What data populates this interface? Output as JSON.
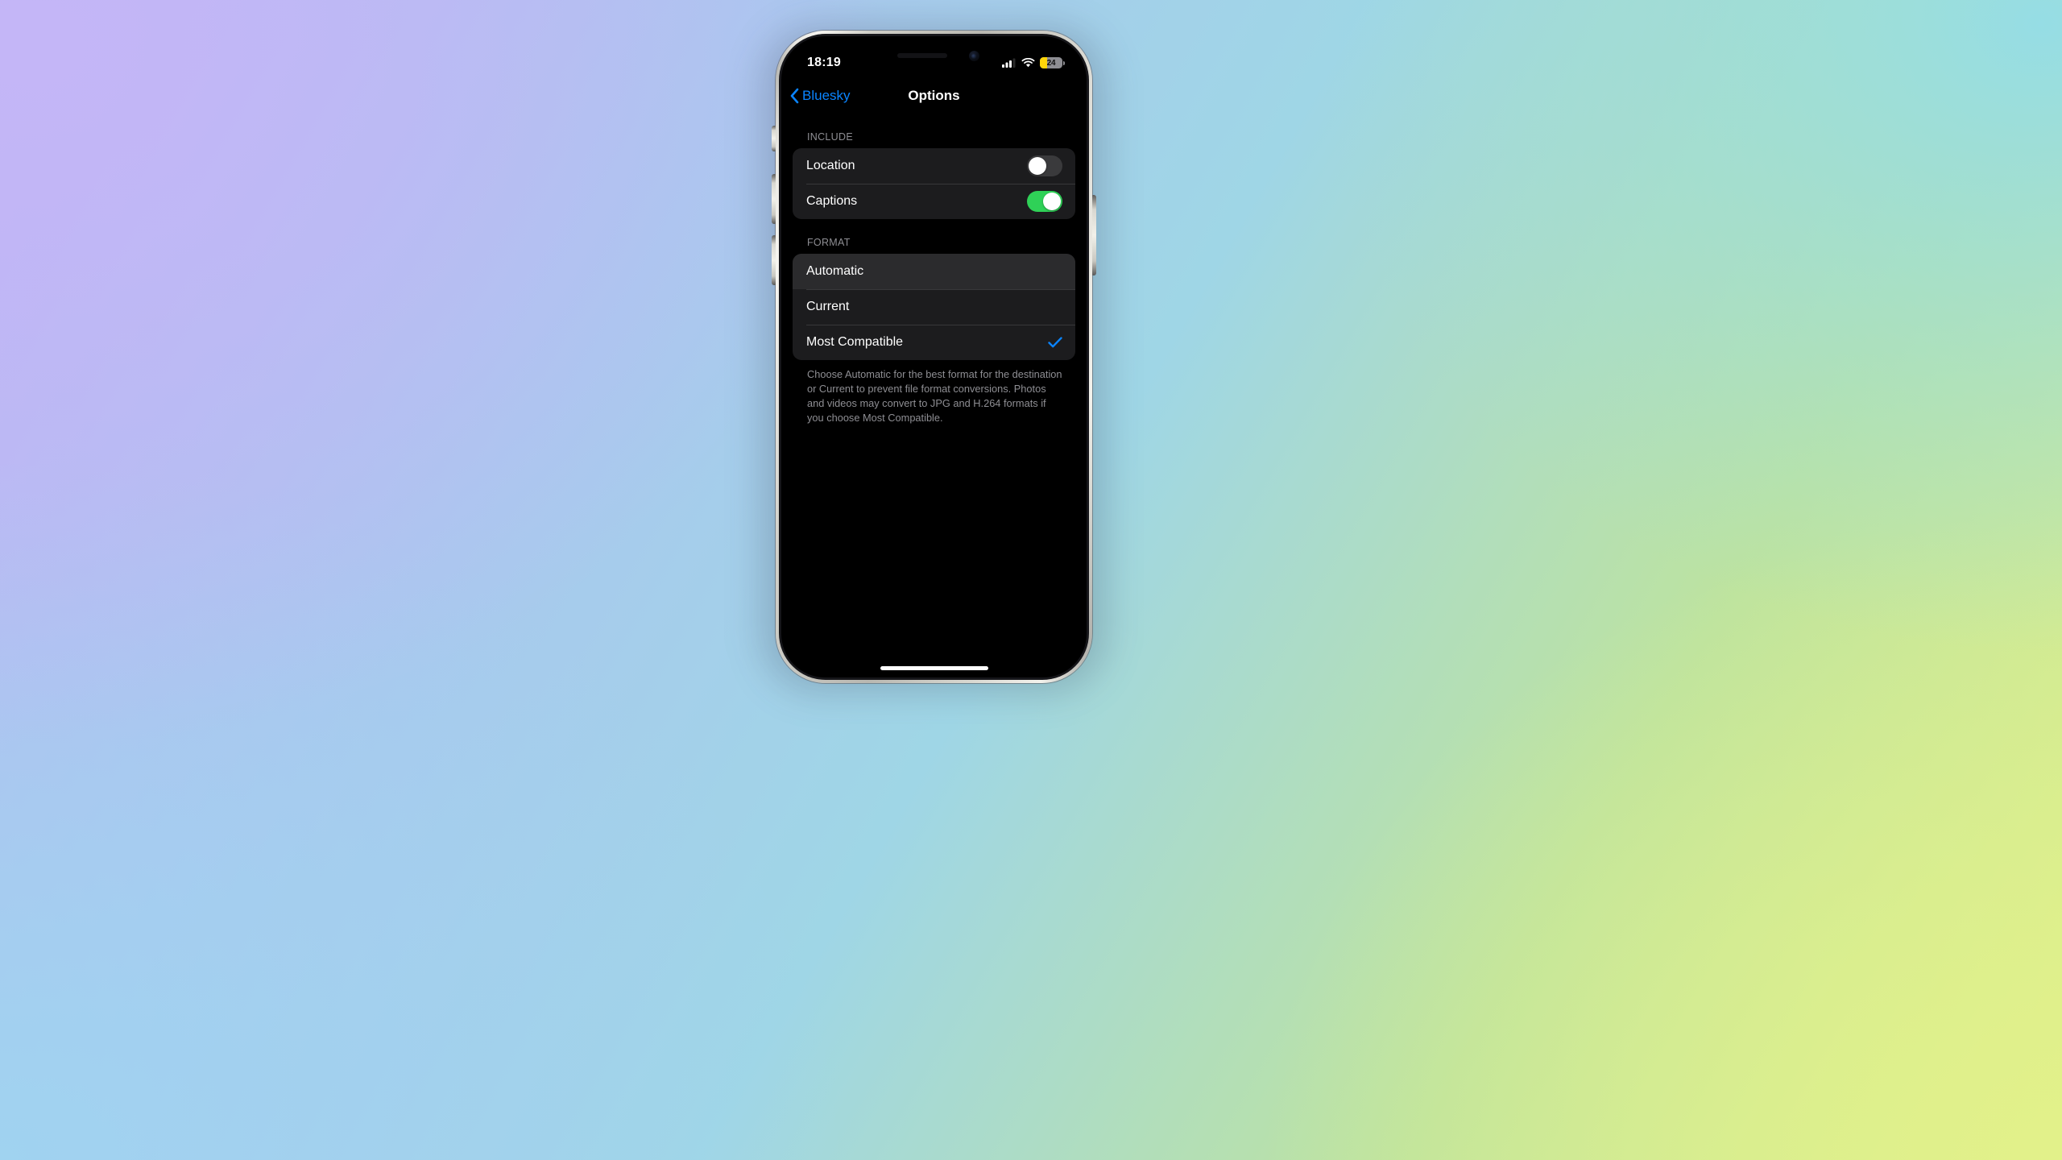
{
  "status_bar": {
    "time": "18:19",
    "signal_icon": "cellular-signal-icon",
    "wifi_icon": "wifi-icon",
    "battery_icon": "battery-icon",
    "battery_level": "24",
    "battery_low_power_color": "#ffd60a"
  },
  "nav": {
    "back_label": "Bluesky",
    "back_icon": "chevron-left-icon",
    "title": "Options",
    "tint_color": "#0a84ff"
  },
  "include_section": {
    "header": "INCLUDE",
    "rows": [
      {
        "label": "Location",
        "switch_state": "off"
      },
      {
        "label": "Captions",
        "switch_state": "on"
      }
    ]
  },
  "format_section": {
    "header": "FORMAT",
    "rows": [
      {
        "label": "Automatic",
        "selected": false,
        "highlighted": true
      },
      {
        "label": "Current",
        "selected": false,
        "highlighted": false
      },
      {
        "label": "Most Compatible",
        "selected": true,
        "highlighted": false
      }
    ],
    "footer": "Choose Automatic for the best format for the destination or Current to prevent file format conversions. Photos and videos may convert to JPG and H.264 formats if you choose Most Compatible.",
    "checkmark_icon": "checkmark-icon",
    "checkmark_color": "#0a84ff"
  },
  "colors": {
    "screen_background": "#000000",
    "card_background": "#1c1c1e",
    "highlight_background": "#2b2b2d",
    "switch_on": "#2fd157",
    "switch_off": "#3a3a3c",
    "secondary_text": "#8e8e93"
  }
}
